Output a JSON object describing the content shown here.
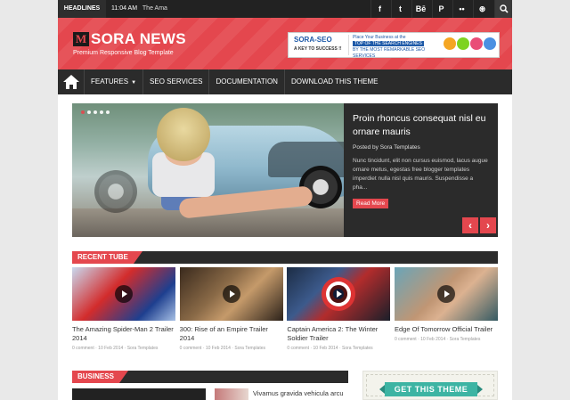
{
  "topbar": {
    "headlines_label": "HEADLINES",
    "ticker_time": "11:04 AM",
    "ticker_text": "The Ama",
    "social": [
      "f",
      "t",
      "Bē",
      "P",
      "••",
      "⊛"
    ]
  },
  "header": {
    "logo_mark": "M",
    "logo_title": "SORA NEWS",
    "tagline": "Premium Responsive Blog Template",
    "ad": {
      "brand": "SORA-SEO",
      "brand_sub": "A KEY TO SUCCESS !!",
      "line1": "Place Your Business at the",
      "line2": "TOP OF THE SEARCH ENGINES",
      "line3": "BY THE MOST REMARKABLE SEO SERVICES"
    }
  },
  "nav": {
    "items": [
      "FEATURES",
      "SEO SERVICES",
      "DOCUMENTATION",
      "DOWNLOAD THIS THEME"
    ]
  },
  "slider": {
    "title": "Proin rhoncus consequat nisl eu ornare mauris",
    "author": "Posted by Sora Templates",
    "excerpt": "Nunc tincidunt, elit non cursus euismod, lacus augue ornare metus, egestas free blogger templates imperdiet nulla nisl quis mauris. Suspendisse a pha...",
    "read_more": "Read More",
    "prev": "‹",
    "next": "›"
  },
  "recent": {
    "label": "RECENT TUBE",
    "videos": [
      {
        "title": "The Amazing Spider-Man 2 Trailer 2014",
        "meta": "0 comment · 10 Feb 2014 · Sora Templates"
      },
      {
        "title": "300: Rise of an Empire Trailer 2014",
        "meta": "0 comment · 10 Feb 2014 · Sora Templates"
      },
      {
        "title": "Captain America 2: The Winter Soldier Trailer",
        "meta": "0 comment · 10 Feb 2014 · Sora Templates"
      },
      {
        "title": "Edge Of Tomorrow Official Trailer",
        "meta": "0 comment · 10 Feb 2014 · Sora Templates"
      }
    ]
  },
  "business": {
    "label": "BUSINESS",
    "post_title": "Vivamus gravida vehicula arcu"
  },
  "get_theme": {
    "label": "GET THIS THEME"
  },
  "colors": {
    "accent": "#e4474e",
    "dark": "#2b2b2b",
    "teal": "#3db4a3"
  }
}
